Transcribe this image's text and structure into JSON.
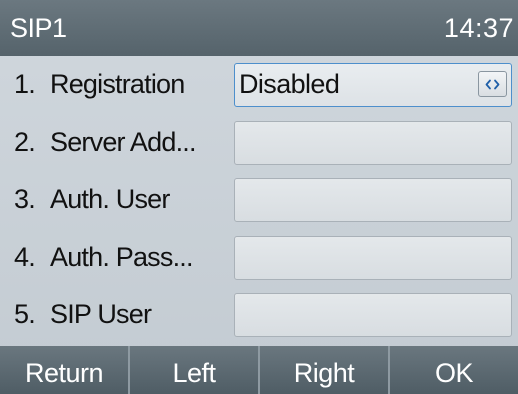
{
  "titlebar": {
    "title": "SIP1",
    "time": "14:37"
  },
  "rows": [
    {
      "index": "1.",
      "label": "Registration",
      "value": "Disabled",
      "selected": true,
      "control": "left-right-arrows-icon"
    },
    {
      "index": "2.",
      "label": "Server Add...",
      "value": ""
    },
    {
      "index": "3.",
      "label": "Auth. User",
      "value": ""
    },
    {
      "index": "4.",
      "label": "Auth. Pass...",
      "value": ""
    },
    {
      "index": "5.",
      "label": "SIP User",
      "value": ""
    }
  ],
  "softkeys": {
    "return": "Return",
    "left": "Left",
    "right": "Right",
    "ok": "OK"
  },
  "colors": {
    "titlebar": "#5f6c74",
    "selection_border": "#4d8fcc",
    "background": "#c8d0d6"
  }
}
